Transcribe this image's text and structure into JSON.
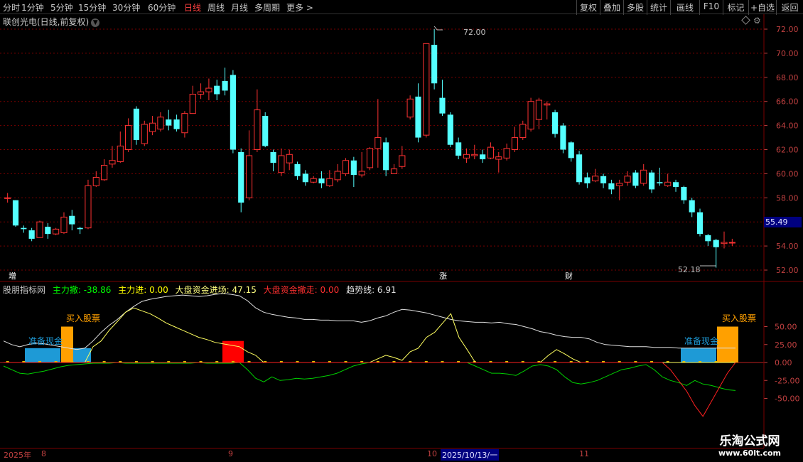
{
  "toolbar": {
    "periods": [
      "分时",
      "1分钟",
      "5分钟",
      "15分钟",
      "30分钟",
      "60分钟",
      "日线",
      "周线",
      "月线",
      "多周期",
      "更多 >"
    ],
    "active_period": "日线",
    "right_buttons": [
      "复权",
      "叠加",
      "多股",
      "统计",
      "画线",
      "F10",
      "标记",
      "+自选",
      "返回"
    ]
  },
  "stock_title": "联创光电(日线,前复权)",
  "price_label": "55.49",
  "colors": {
    "up": "#ff3232",
    "down": "#54ffff",
    "grid": "#7a0000",
    "axis": "#c04040"
  },
  "indicator": {
    "name": "股朋指标网",
    "fields": [
      {
        "label": "主力撤: -38.86",
        "color": "#00ff00"
      },
      {
        "label": "主力进: 0.00",
        "color": "#ffff00"
      },
      {
        "label": "大盘资金进场: 47.15",
        "color": "#ffff80"
      },
      {
        "label": "大盘资金撤走: 0.00",
        "color": "#ff3030"
      },
      {
        "label": "趋势线: 6.91",
        "color": "#e0e0e0"
      }
    ],
    "annotations": {
      "buy": "买入股票",
      "prepare": "准备现金"
    }
  },
  "events": [
    "增",
    "涨",
    "财"
  ],
  "dates": {
    "year": "2025年",
    "m8": "8",
    "m9": "9",
    "m10": "10",
    "highlight": "2025/10/13/一",
    "m11": "11"
  },
  "watermark": {
    "line1": "乐淘公式网",
    "line2": "www.60lt.com"
  },
  "chart_data": [
    {
      "type": "candlestick",
      "title": "联创光电(日线,前复权)",
      "ylim": [
        51.0,
        73.0
      ],
      "yticks": [
        52.0,
        54.0,
        56.0,
        58.0,
        60.0,
        62.0,
        64.0,
        66.0,
        68.0,
        70.0,
        72.0
      ],
      "high_label": "72.00",
      "low_label": "52.18",
      "candles": [
        [
          58.0,
          58.0,
          58.4,
          57.6
        ],
        [
          57.8,
          55.7,
          57.8,
          55.6
        ],
        [
          55.5,
          55.4,
          55.7,
          55.1
        ],
        [
          55.3,
          54.6,
          55.5,
          54.4
        ],
        [
          54.7,
          56.0,
          56.1,
          54.7
        ],
        [
          55.6,
          55.0,
          55.9,
          54.6
        ],
        [
          55.0,
          55.4,
          55.5,
          54.9
        ],
        [
          55.1,
          56.4,
          56.8,
          55.0
        ],
        [
          56.5,
          55.8,
          57.0,
          55.3
        ],
        [
          55.5,
          55.4,
          55.6,
          55.0
        ],
        [
          55.5,
          59.0,
          59.5,
          55.4
        ],
        [
          59.0,
          59.7,
          60.2,
          58.9
        ],
        [
          59.5,
          60.7,
          61.2,
          59.4
        ],
        [
          60.8,
          61.1,
          62.3,
          60.5
        ],
        [
          61.0,
          62.3,
          63.5,
          60.9
        ],
        [
          62.0,
          64.0,
          64.6,
          61.8
        ],
        [
          65.4,
          62.8,
          65.6,
          62.4
        ],
        [
          62.5,
          64.1,
          64.4,
          62.3
        ],
        [
          63.5,
          64.2,
          64.8,
          63.2
        ],
        [
          63.7,
          64.7,
          65.1,
          63.5
        ],
        [
          64.5,
          64.0,
          65.3,
          63.6
        ],
        [
          64.5,
          63.7,
          64.9,
          63.5
        ],
        [
          63.4,
          65.0,
          65.2,
          63.0
        ],
        [
          65.0,
          66.6,
          67.3,
          65.0
        ],
        [
          66.6,
          66.8,
          67.5,
          66.2
        ],
        [
          66.8,
          67.1,
          67.9,
          66.1
        ],
        [
          67.3,
          66.6,
          67.8,
          66.1
        ],
        [
          67.7,
          66.9,
          68.8,
          66.5
        ],
        [
          68.2,
          62.0,
          68.6,
          61.7
        ],
        [
          61.8,
          57.6,
          62.1,
          56.8
        ],
        [
          58.0,
          61.5,
          63.6,
          57.8
        ],
        [
          62.0,
          65.3,
          67.0,
          61.8
        ],
        [
          64.8,
          62.3,
          65.1,
          62.2
        ],
        [
          61.8,
          60.9,
          62.0,
          60.2
        ],
        [
          60.1,
          61.5,
          62.1,
          59.8
        ],
        [
          60.9,
          61.6,
          62.0,
          60.3
        ],
        [
          60.8,
          59.8,
          61.0,
          59.5
        ],
        [
          60.0,
          59.3,
          60.3,
          59.0
        ],
        [
          59.3,
          59.6,
          59.8,
          59.2
        ],
        [
          59.6,
          59.2,
          60.2,
          58.8
        ],
        [
          59.0,
          59.6,
          60.3,
          58.9
        ],
        [
          59.5,
          60.2,
          60.8,
          59.3
        ],
        [
          60.0,
          61.1,
          61.3,
          59.8
        ],
        [
          61.1,
          59.9,
          61.4,
          58.9
        ],
        [
          59.9,
          60.2,
          61.8,
          59.7
        ],
        [
          60.5,
          62.1,
          62.2,
          60.3
        ],
        [
          62.1,
          63.0,
          66.2,
          60.5
        ],
        [
          62.6,
          60.3,
          63.0,
          59.8
        ],
        [
          60.0,
          60.4,
          60.8,
          60.0
        ],
        [
          60.6,
          61.5,
          62.3,
          60.4
        ],
        [
          64.7,
          66.2,
          66.5,
          64.5
        ],
        [
          66.4,
          63.0,
          67.5,
          62.6
        ],
        [
          63.2,
          70.8,
          70.8,
          63.0
        ],
        [
          70.7,
          67.5,
          72.0,
          67.0
        ],
        [
          66.3,
          65.0,
          67.8,
          64.8
        ],
        [
          64.9,
          62.4,
          65.1,
          62.2
        ],
        [
          62.6,
          61.5,
          63.0,
          61.2
        ],
        [
          61.3,
          61.6,
          62.1,
          60.9
        ],
        [
          61.5,
          61.6,
          62.4,
          61.2
        ],
        [
          61.6,
          61.2,
          62.0,
          60.9
        ],
        [
          61.3,
          62.2,
          62.6,
          61.2
        ],
        [
          61.2,
          61.4,
          61.8,
          60.1
        ],
        [
          61.3,
          62.1,
          62.5,
          61.1
        ],
        [
          62.0,
          63.0,
          63.9,
          61.8
        ],
        [
          63.0,
          64.1,
          64.4,
          62.8
        ],
        [
          63.7,
          66.0,
          66.3,
          63.5
        ],
        [
          64.5,
          66.1,
          66.3,
          63.7
        ],
        [
          65.7,
          65.8,
          66.0,
          64.5
        ],
        [
          65.1,
          63.3,
          65.3,
          63.0
        ],
        [
          64.0,
          62.0,
          64.2,
          61.7
        ],
        [
          62.6,
          61.3,
          62.7,
          61.0
        ],
        [
          61.6,
          59.3,
          61.9,
          59.1
        ],
        [
          59.7,
          59.2,
          60.1,
          58.8
        ],
        [
          59.4,
          59.8,
          60.4,
          59.3
        ],
        [
          59.8,
          59.2,
          60.0,
          58.8
        ],
        [
          59.2,
          58.7,
          59.5,
          58.3
        ],
        [
          59.0,
          59.2,
          59.5,
          57.8
        ],
        [
          59.3,
          59.8,
          60.2,
          59.0
        ],
        [
          60.1,
          59.0,
          60.3,
          58.8
        ],
        [
          59.2,
          60.3,
          60.8,
          59.0
        ],
        [
          60.1,
          58.7,
          60.3,
          58.4
        ],
        [
          59.3,
          59.2,
          60.5,
          59.0
        ],
        [
          59.0,
          59.3,
          60.0,
          58.9
        ],
        [
          59.3,
          58.9,
          59.5,
          58.5
        ],
        [
          58.9,
          57.8,
          59.0,
          57.5
        ],
        [
          57.8,
          56.8,
          58.0,
          56.4
        ],
        [
          56.8,
          55.0,
          57.1,
          54.8
        ],
        [
          54.9,
          54.4,
          55.0,
          54.0
        ],
        [
          54.5,
          53.9,
          54.6,
          52.2
        ],
        [
          54.2,
          54.3,
          55.2,
          53.8
        ],
        [
          54.3,
          54.3,
          54.6,
          54.0
        ]
      ]
    },
    {
      "type": "line",
      "title": "股朋指标网",
      "ylim": [
        -80,
        60
      ],
      "yticks": [
        50.0,
        25.0,
        0.0,
        -25.0,
        -50.0
      ],
      "series": [
        {
          "name": "趋势线",
          "values": [
            30,
            25,
            22,
            25,
            27,
            26,
            24,
            22,
            20,
            18,
            20,
            30,
            42,
            52,
            60,
            70,
            78,
            85,
            88,
            90,
            92,
            93,
            94,
            93,
            92,
            93,
            95,
            96,
            95,
            93,
            86,
            76,
            70,
            67,
            65,
            63,
            62,
            60,
            60,
            59,
            59,
            58,
            58,
            58,
            56,
            58,
            62,
            65,
            70,
            74,
            73,
            71,
            69,
            66,
            63,
            60,
            58,
            57,
            56,
            56,
            55,
            56,
            54,
            53,
            50,
            47,
            43,
            41,
            38,
            36,
            35,
            35,
            33,
            28,
            25,
            24,
            23,
            22,
            22,
            22,
            21,
            21,
            21,
            20,
            20,
            20,
            20,
            20,
            20,
            20,
            20
          ]
        },
        {
          "name": "大盘资金进场",
          "values": [
            0,
            0,
            0,
            0,
            0,
            0,
            0,
            0,
            0,
            0,
            0,
            22,
            30,
            45,
            57,
            70,
            76,
            72,
            68,
            62,
            55,
            50,
            45,
            40,
            35,
            32,
            28,
            26,
            24,
            22,
            15,
            10,
            0,
            0,
            0,
            0,
            0,
            0,
            0,
            0,
            0,
            0,
            0,
            0,
            0,
            0,
            5,
            10,
            7,
            3,
            15,
            20,
            35,
            42,
            55,
            68,
            35,
            18,
            0,
            0,
            0,
            0,
            0,
            0,
            0,
            0,
            0,
            10,
            18,
            12,
            5,
            0,
            0,
            0,
            0,
            0,
            0,
            0,
            0,
            0,
            0,
            0,
            0,
            0,
            0,
            0,
            0,
            0,
            0,
            0,
            0
          ]
        },
        {
          "name": "主力撤",
          "values": [
            -5,
            -10,
            -15,
            -16,
            -14,
            -12,
            -9,
            -6,
            -4,
            -3,
            -2,
            -1,
            -1,
            -1,
            0,
            -1,
            -1,
            -1,
            -1,
            -1,
            -1,
            -1,
            -1,
            -1,
            0,
            -1,
            -1,
            -1,
            -1,
            0,
            -10,
            -22,
            -27,
            -20,
            -25,
            -24,
            -22,
            -23,
            -22,
            -20,
            -18,
            -15,
            -10,
            -5,
            -2,
            0,
            0,
            0,
            0,
            0,
            0,
            0,
            0,
            0,
            0,
            0,
            0,
            0,
            -5,
            -10,
            -15,
            -15,
            -16,
            -18,
            -12,
            -5,
            -3,
            -5,
            -10,
            -20,
            -28,
            -30,
            -28,
            -25,
            -20,
            -15,
            -10,
            -8,
            -5,
            -3,
            -10,
            -20,
            -25,
            -28,
            -32,
            -25,
            -30,
            -32,
            -35,
            -38,
            -39
          ]
        },
        {
          "name": "大盘资金撤走",
          "values": [
            0,
            0,
            0,
            0,
            0,
            0,
            0,
            0,
            0,
            0,
            0,
            0,
            0,
            0,
            0,
            0,
            0,
            0,
            0,
            0,
            0,
            0,
            0,
            0,
            0,
            0,
            0,
            0,
            0,
            0,
            0,
            0,
            0,
            0,
            0,
            0,
            0,
            0,
            0,
            0,
            0,
            0,
            0,
            0,
            0,
            0,
            0,
            0,
            0,
            0,
            0,
            0,
            0,
            0,
            0,
            0,
            0,
            0,
            0,
            0,
            0,
            0,
            0,
            0,
            0,
            0,
            0,
            0,
            0,
            0,
            0,
            0,
            0,
            0,
            0,
            0,
            0,
            0,
            0,
            0,
            0,
            0,
            -10,
            -25,
            -40,
            -60,
            -75,
            -55,
            -35,
            -15,
            0
          ]
        }
      ]
    }
  ]
}
